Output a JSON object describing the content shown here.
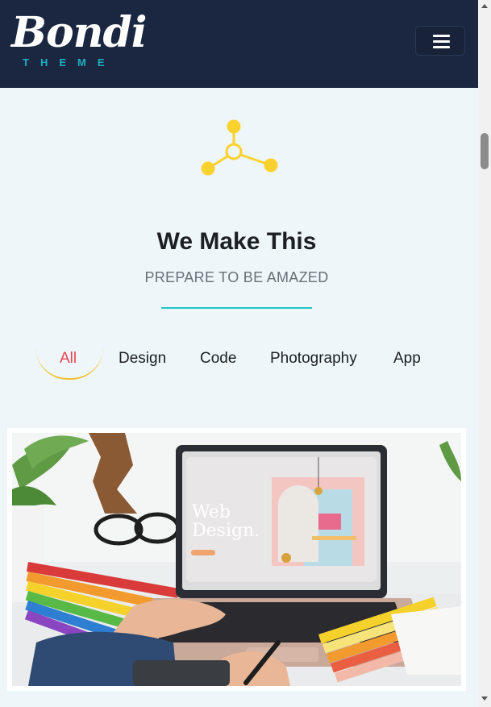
{
  "header": {
    "logo_script": "Bondi",
    "logo_sub": "THEME",
    "menu_icon": "hamburger-icon"
  },
  "section": {
    "icon": "share-nodes-icon",
    "title": "We Make This",
    "subtitle": "PREPARE TO BE AMAZED"
  },
  "filters": [
    {
      "label": "All",
      "active": true
    },
    {
      "label": "Design",
      "active": false
    },
    {
      "label": "Code",
      "active": false
    },
    {
      "label": "Photography",
      "active": false
    },
    {
      "label": "App",
      "active": false
    }
  ],
  "portfolio": {
    "screen_title_line1": "Web",
    "screen_title_line2": "Design."
  },
  "colors": {
    "navbar": "#1b2640",
    "accent_teal": "#1fc4c6",
    "accent_yellow": "#f2c230",
    "active_filter": "#e8444f",
    "icon_yellow": "#fbd12d"
  }
}
